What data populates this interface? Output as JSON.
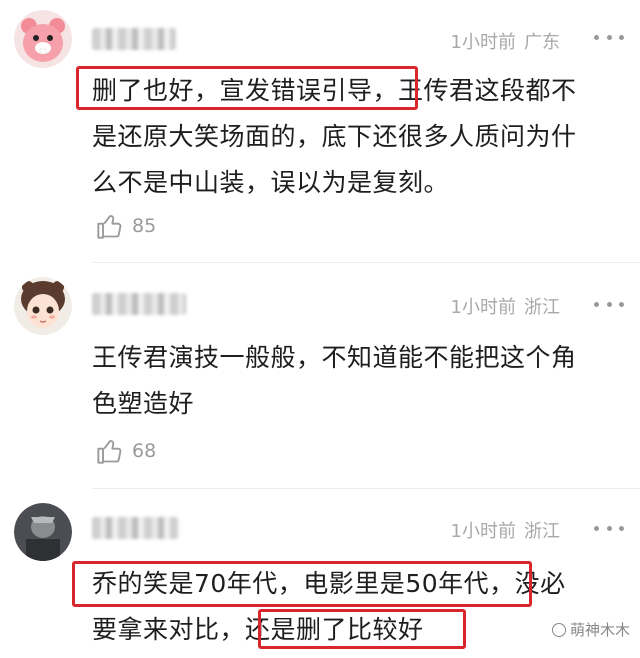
{
  "comments": [
    {
      "meta": {
        "time": "1小时前",
        "location": "广东"
      },
      "text_lines": [
        "删了也好，宣发错误引导，王传君这段都不",
        "是还原大笑场面的，底下还很多人质问为什",
        "么不是中山装，误以为是复刻。"
      ],
      "likes": "85",
      "avatar": "pink-bear-avatar"
    },
    {
      "meta": {
        "time": "1小时前",
        "location": "浙江"
      },
      "text_lines": [
        "王传君演技一般般，不知道能不能把这个角",
        "色塑造好"
      ],
      "likes": "68",
      "avatar": "cartoon-girl-avatar"
    },
    {
      "meta": {
        "time": "1小时前",
        "location": "浙江"
      },
      "text_lines": [
        "乔的笑是70年代，电影里是50年代，没必",
        "要拿来对比，还是删了比较好"
      ],
      "avatar": "dark-photo-avatar"
    }
  ],
  "watermark": "萌神木木",
  "colors": {
    "highlight": "#d9262c",
    "meta_gray": "#a8a8a8",
    "text": "#1e1e1e"
  },
  "icons": [
    "thumbs-up-icon",
    "more-dots-icon"
  ]
}
